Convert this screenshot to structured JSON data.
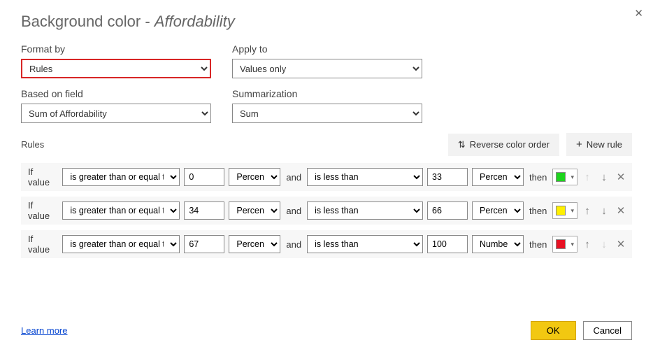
{
  "title": {
    "prefix": "Background color - ",
    "field": "Affordability"
  },
  "close_glyph": "✕",
  "labels": {
    "format_by": "Format by",
    "apply_to": "Apply to",
    "based_on_field": "Based on field",
    "summarization": "Summarization",
    "rules": "Rules"
  },
  "dropdowns": {
    "format_by": "Rules",
    "apply_to": "Values only",
    "based_on_field": "Sum of Affordability",
    "summarization": "Sum"
  },
  "buttons": {
    "reverse": "Reverse color order",
    "new_rule": "New rule",
    "ok": "OK",
    "cancel": "Cancel"
  },
  "rule_text": {
    "if_value": "If value",
    "and": "and",
    "then": "then"
  },
  "rules": [
    {
      "op1": "is greater than or equal to",
      "val1": "0",
      "unit1": "Percent",
      "op2": "is less than",
      "val2": "33",
      "unit2": "Percent",
      "color": "#1fd41f",
      "up_disabled": true,
      "down_disabled": false
    },
    {
      "op1": "is greater than or equal to",
      "val1": "34",
      "unit1": "Percent",
      "op2": "is less than",
      "val2": "66",
      "unit2": "Percent",
      "color": "#fff000",
      "up_disabled": false,
      "down_disabled": false
    },
    {
      "op1": "is greater than or equal to",
      "val1": "67",
      "unit1": "Percent",
      "op2": "is less than",
      "val2": "100",
      "unit2": "Number",
      "color": "#e81123",
      "up_disabled": false,
      "down_disabled": true
    }
  ],
  "learn_more": "Learn more",
  "glyphs": {
    "swap": "⇅",
    "plus": "+",
    "up": "↑",
    "down": "↓",
    "x": "✕",
    "caret": "▾"
  }
}
